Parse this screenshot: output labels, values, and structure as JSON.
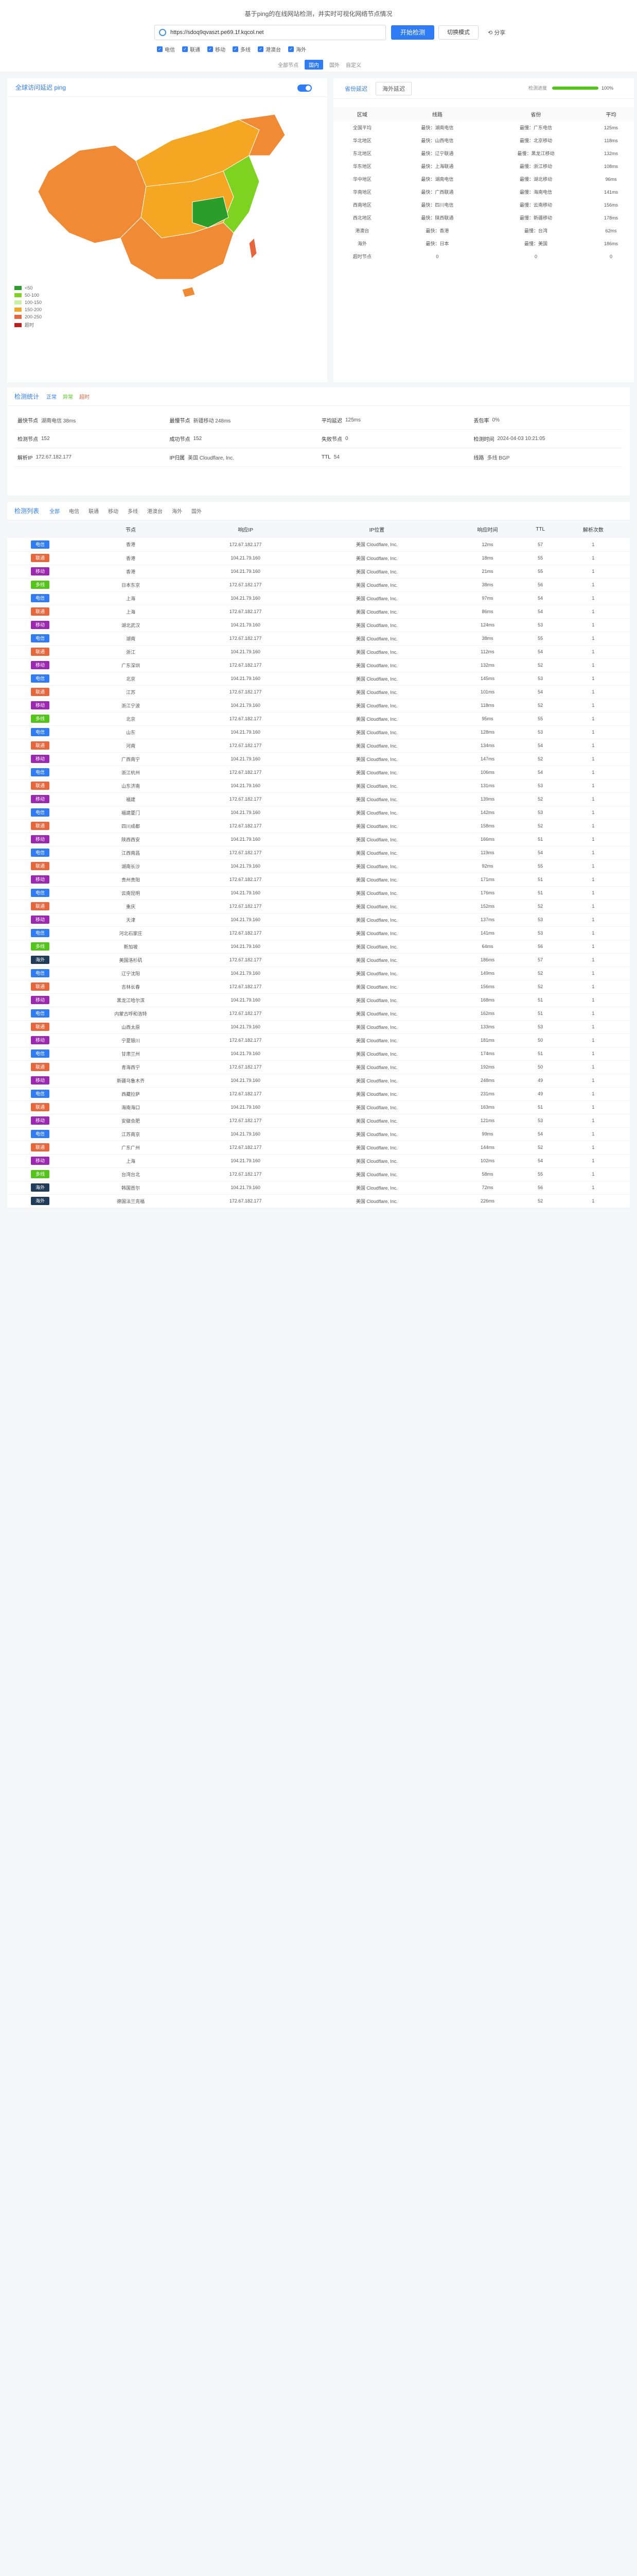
{
  "topbar": {
    "hint": "基于ping的在线网站检测，并实时可视化网络节点情况",
    "url": "https://sdoq9qvaszt.pe69.1f.kqcol.net",
    "btn_detect": "开始检测",
    "btn_multi": "切换模式",
    "btn_share": "分享",
    "options": [
      "电信",
      "联通",
      "移动",
      "多线",
      "港澳台",
      "海外"
    ],
    "sub_options": [
      "全部节点",
      "国内",
      "国外",
      "自定义"
    ]
  },
  "map": {
    "title": "全球访问延迟 ping",
    "legend": [
      {
        "label": "<50",
        "color": "#2a9d2a"
      },
      {
        "label": "50-100",
        "color": "#7ed321"
      },
      {
        "label": "100-150",
        "color": "#c9f2a0"
      },
      {
        "label": "150-200",
        "color": "#f5a623"
      },
      {
        "label": "200-250",
        "color": "#e8663c"
      },
      {
        "label": "超时",
        "color": "#c01c1c"
      }
    ]
  },
  "stats": {
    "tab1": "省份延迟",
    "tab2": "海外延迟",
    "progress_label": "检测进度",
    "progress": 100,
    "columns": [
      "区域",
      "线路",
      "省份",
      "平均"
    ],
    "rows": [
      [
        "全国平均",
        "最快：湖南电信",
        "最慢：广东电信",
        "125ms"
      ],
      [
        "华北地区",
        "最快：山西电信",
        "最慢：北京移动",
        "118ms"
      ],
      [
        "东北地区",
        "最快：辽宁联通",
        "最慢：黑龙江移动",
        "132ms"
      ],
      [
        "华东地区",
        "最快：上海联通",
        "最慢：浙江移动",
        "108ms"
      ],
      [
        "华中地区",
        "最快：湖南电信",
        "最慢：湖北移动",
        "96ms"
      ],
      [
        "华南地区",
        "最快：广西联通",
        "最慢：海南电信",
        "141ms"
      ],
      [
        "西南地区",
        "最快：四川电信",
        "最慢：云南移动",
        "156ms"
      ],
      [
        "西北地区",
        "最快：陕西联通",
        "最慢：新疆移动",
        "178ms"
      ],
      [
        "港澳台",
        "最快：香港",
        "最慢：台湾",
        "62ms"
      ],
      [
        "海外",
        "最快：日本",
        "最慢：美国",
        "186ms"
      ],
      [
        "超时节点",
        "0",
        "0",
        "0"
      ]
    ]
  },
  "summary": {
    "title": "检测统计",
    "pills": [
      "正常",
      "异常",
      "超时"
    ],
    "cells": [
      [
        "最快节点",
        "湖南电信 38ms"
      ],
      [
        "最慢节点",
        "新疆移动 248ms"
      ],
      [
        "平均延迟",
        "125ms"
      ],
      [
        "丢包率",
        "0%"
      ],
      [
        "检测节点",
        "152"
      ],
      [
        "成功节点",
        "152"
      ],
      [
        "失败节点",
        "0"
      ],
      [
        "检测时间",
        "2024-04-03 10:21:05"
      ],
      [
        "解析IP",
        "172.67.182.177"
      ],
      [
        "IP归属",
        "美国 Cloudflare, Inc."
      ],
      [
        "TTL",
        "54"
      ],
      [
        "线路",
        "多线 BGP"
      ]
    ]
  },
  "detail": {
    "title": "检测列表",
    "filters": [
      "全部",
      "电信",
      "联通",
      "移动",
      "多线",
      "港澳台",
      "海外",
      "国外"
    ],
    "columns": [
      "",
      "节点",
      "响应IP",
      "IP位置",
      "响应时间",
      "TTL",
      "解析次数"
    ],
    "isp_colors": {
      "电信": "#2f7cf6",
      "联通": "#e8663c",
      "移动": "#9c27b0",
      "多线": "#52c41a",
      "海外": "#1f3b57"
    },
    "rows": [
      [
        "电信",
        "香港",
        "172.67.182.177",
        "美国 Cloudflare, Inc.",
        "12ms",
        "57",
        "1"
      ],
      [
        "联通",
        "香港",
        "104.21.79.160",
        "美国 Cloudflare, Inc.",
        "18ms",
        "55",
        "1"
      ],
      [
        "移动",
        "香港",
        "104.21.79.160",
        "美国 Cloudflare, Inc.",
        "21ms",
        "55",
        "1"
      ],
      [
        "多线",
        "日本东京",
        "172.67.182.177",
        "美国 Cloudflare, Inc.",
        "38ms",
        "56",
        "1"
      ],
      [
        "电信",
        "上海",
        "104.21.79.160",
        "美国 Cloudflare, Inc.",
        "97ms",
        "54",
        "1"
      ],
      [
        "联通",
        "上海",
        "172.67.182.177",
        "美国 Cloudflare, Inc.",
        "86ms",
        "54",
        "1"
      ],
      [
        "移动",
        "湖北武汉",
        "104.21.79.160",
        "美国 Cloudflare, Inc.",
        "124ms",
        "53",
        "1"
      ],
      [
        "电信",
        "湖南",
        "172.67.182.177",
        "美国 Cloudflare, Inc.",
        "38ms",
        "55",
        "1"
      ],
      [
        "联通",
        "浙江",
        "104.21.79.160",
        "美国 Cloudflare, Inc.",
        "112ms",
        "54",
        "1"
      ],
      [
        "移动",
        "广东深圳",
        "172.67.182.177",
        "美国 Cloudflare, Inc.",
        "132ms",
        "52",
        "1"
      ],
      [
        "电信",
        "北京",
        "104.21.79.160",
        "美国 Cloudflare, Inc.",
        "145ms",
        "53",
        "1"
      ],
      [
        "联通",
        "江苏",
        "172.67.182.177",
        "美国 Cloudflare, Inc.",
        "101ms",
        "54",
        "1"
      ],
      [
        "移动",
        "浙江宁波",
        "104.21.79.160",
        "美国 Cloudflare, Inc.",
        "118ms",
        "52",
        "1"
      ],
      [
        "多线",
        "北京",
        "172.67.182.177",
        "美国 Cloudflare, Inc.",
        "95ms",
        "55",
        "1"
      ],
      [
        "电信",
        "山东",
        "104.21.79.160",
        "美国 Cloudflare, Inc.",
        "128ms",
        "53",
        "1"
      ],
      [
        "联通",
        "河南",
        "172.67.182.177",
        "美国 Cloudflare, Inc.",
        "134ms",
        "54",
        "1"
      ],
      [
        "移动",
        "广西南宁",
        "104.21.79.160",
        "美国 Cloudflare, Inc.",
        "147ms",
        "52",
        "1"
      ],
      [
        "电信",
        "浙江杭州",
        "172.67.182.177",
        "美国 Cloudflare, Inc.",
        "106ms",
        "54",
        "1"
      ],
      [
        "联通",
        "山东济南",
        "104.21.79.160",
        "美国 Cloudflare, Inc.",
        "131ms",
        "53",
        "1"
      ],
      [
        "移动",
        "福建",
        "172.67.182.177",
        "美国 Cloudflare, Inc.",
        "139ms",
        "52",
        "1"
      ],
      [
        "电信",
        "福建厦门",
        "104.21.79.160",
        "美国 Cloudflare, Inc.",
        "142ms",
        "53",
        "1"
      ],
      [
        "联通",
        "四川成都",
        "172.67.182.177",
        "美国 Cloudflare, Inc.",
        "158ms",
        "52",
        "1"
      ],
      [
        "移动",
        "陕西西安",
        "104.21.79.160",
        "美国 Cloudflare, Inc.",
        "166ms",
        "51",
        "1"
      ],
      [
        "电信",
        "江西南昌",
        "172.67.182.177",
        "美国 Cloudflare, Inc.",
        "119ms",
        "54",
        "1"
      ],
      [
        "联通",
        "湖南长沙",
        "104.21.79.160",
        "美国 Cloudflare, Inc.",
        "92ms",
        "55",
        "1"
      ],
      [
        "移动",
        "贵州贵阳",
        "172.67.182.177",
        "美国 Cloudflare, Inc.",
        "171ms",
        "51",
        "1"
      ],
      [
        "电信",
        "云南昆明",
        "104.21.79.160",
        "美国 Cloudflare, Inc.",
        "176ms",
        "51",
        "1"
      ],
      [
        "联通",
        "重庆",
        "172.67.182.177",
        "美国 Cloudflare, Inc.",
        "152ms",
        "52",
        "1"
      ],
      [
        "移动",
        "天津",
        "104.21.79.160",
        "美国 Cloudflare, Inc.",
        "137ms",
        "53",
        "1"
      ],
      [
        "电信",
        "河北石家庄",
        "172.67.182.177",
        "美国 Cloudflare, Inc.",
        "141ms",
        "53",
        "1"
      ],
      [
        "多线",
        "新加坡",
        "104.21.79.160",
        "美国 Cloudflare, Inc.",
        "64ms",
        "56",
        "1"
      ],
      [
        "海外",
        "美国洛杉矶",
        "172.67.182.177",
        "美国 Cloudflare, Inc.",
        "186ms",
        "57",
        "1"
      ],
      [
        "电信",
        "辽宁沈阳",
        "104.21.79.160",
        "美国 Cloudflare, Inc.",
        "149ms",
        "52",
        "1"
      ],
      [
        "联通",
        "吉林长春",
        "172.67.182.177",
        "美国 Cloudflare, Inc.",
        "156ms",
        "52",
        "1"
      ],
      [
        "移动",
        "黑龙江哈尔滨",
        "104.21.79.160",
        "美国 Cloudflare, Inc.",
        "168ms",
        "51",
        "1"
      ],
      [
        "电信",
        "内蒙古呼和浩特",
        "172.67.182.177",
        "美国 Cloudflare, Inc.",
        "162ms",
        "51",
        "1"
      ],
      [
        "联通",
        "山西太原",
        "104.21.79.160",
        "美国 Cloudflare, Inc.",
        "133ms",
        "53",
        "1"
      ],
      [
        "移动",
        "宁夏银川",
        "172.67.182.177",
        "美国 Cloudflare, Inc.",
        "181ms",
        "50",
        "1"
      ],
      [
        "电信",
        "甘肃兰州",
        "104.21.79.160",
        "美国 Cloudflare, Inc.",
        "174ms",
        "51",
        "1"
      ],
      [
        "联通",
        "青海西宁",
        "172.67.182.177",
        "美国 Cloudflare, Inc.",
        "192ms",
        "50",
        "1"
      ],
      [
        "移动",
        "新疆乌鲁木齐",
        "104.21.79.160",
        "美国 Cloudflare, Inc.",
        "248ms",
        "49",
        "1"
      ],
      [
        "电信",
        "西藏拉萨",
        "172.67.182.177",
        "美国 Cloudflare, Inc.",
        "231ms",
        "49",
        "1"
      ],
      [
        "联通",
        "海南海口",
        "104.21.79.160",
        "美国 Cloudflare, Inc.",
        "163ms",
        "51",
        "1"
      ],
      [
        "移动",
        "安徽合肥",
        "172.67.182.177",
        "美国 Cloudflare, Inc.",
        "121ms",
        "53",
        "1"
      ],
      [
        "电信",
        "江苏南京",
        "104.21.79.160",
        "美国 Cloudflare, Inc.",
        "99ms",
        "54",
        "1"
      ],
      [
        "联通",
        "广东广州",
        "172.67.182.177",
        "美国 Cloudflare, Inc.",
        "144ms",
        "52",
        "1"
      ],
      [
        "移动",
        "上海",
        "104.21.79.160",
        "美国 Cloudflare, Inc.",
        "102ms",
        "54",
        "1"
      ],
      [
        "多线",
        "台湾台北",
        "172.67.182.177",
        "美国 Cloudflare, Inc.",
        "58ms",
        "55",
        "1"
      ],
      [
        "海外",
        "韩国首尔",
        "104.21.79.160",
        "美国 Cloudflare, Inc.",
        "72ms",
        "56",
        "1"
      ],
      [
        "海外",
        "德国法兰克福",
        "172.67.182.177",
        "美国 Cloudflare, Inc.",
        "226ms",
        "52",
        "1"
      ]
    ]
  }
}
